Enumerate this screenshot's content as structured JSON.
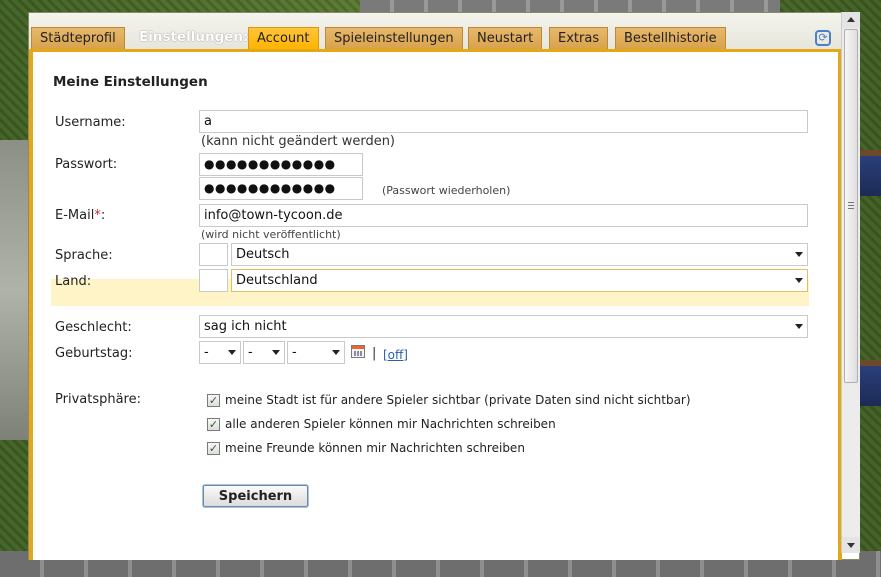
{
  "tabs": {
    "staedteprofil": "Städteprofil",
    "einstellungen_label": "Einstellungen:",
    "account": "Account",
    "spieleinstellungen": "Spieleinstellungen",
    "neustart": "Neustart",
    "extras": "Extras",
    "bestellhistorie": "Bestellhistorie"
  },
  "form": {
    "heading": "Meine Einstellungen",
    "username": {
      "label": "Username:",
      "value": "a",
      "note": "(kann nicht geändert werden)"
    },
    "password": {
      "label": "Passwort:",
      "value": "●●●●●●●●●●●●",
      "repeat_value": "●●●●●●●●●●●●",
      "repeat_note": "(Passwort wiederholen)"
    },
    "email": {
      "label": "E-Mail",
      "required": "*",
      "colon": ":",
      "value": "info@town-tycoon.de",
      "note": "(wird nicht veröffentlicht)"
    },
    "language": {
      "label": "Sprache:",
      "value": "Deutsch"
    },
    "country": {
      "label": "Land:",
      "value": "Deutschland"
    },
    "gender": {
      "label": "Geschlecht:",
      "value": "sag ich nicht"
    },
    "birthday": {
      "label": "Geburtstag:",
      "day": "-",
      "month": "-",
      "year": "-",
      "separator": "|",
      "off_link": "[off]"
    },
    "privacy": {
      "label": "Privatsphäre:",
      "options": [
        {
          "label": "meine Stadt ist für andere Spieler sichtbar (private Daten sind nicht sichtbar)",
          "checked": true,
          "mark": "✓"
        },
        {
          "label": "alle anderen Spieler können mir Nachrichten schreiben",
          "checked": true,
          "mark": "✓"
        },
        {
          "label": "meine Freunde können mir Nachrichten schreiben",
          "checked": true,
          "mark": "✓"
        }
      ]
    },
    "save_label": "Speichern"
  },
  "colors": {
    "tab_active": "#ffb400",
    "tab_inactive": "#d9a24c",
    "frame_border": "#e2a816",
    "highlight_row": "#fff4c8",
    "required_mark": "#c03030",
    "link": "#2a5fb0"
  },
  "icons": {
    "refresh": "refresh-icon",
    "calendar": "calendar-icon",
    "dropdown": "chevron-down-icon",
    "checkbox": "checkbox-icon"
  }
}
